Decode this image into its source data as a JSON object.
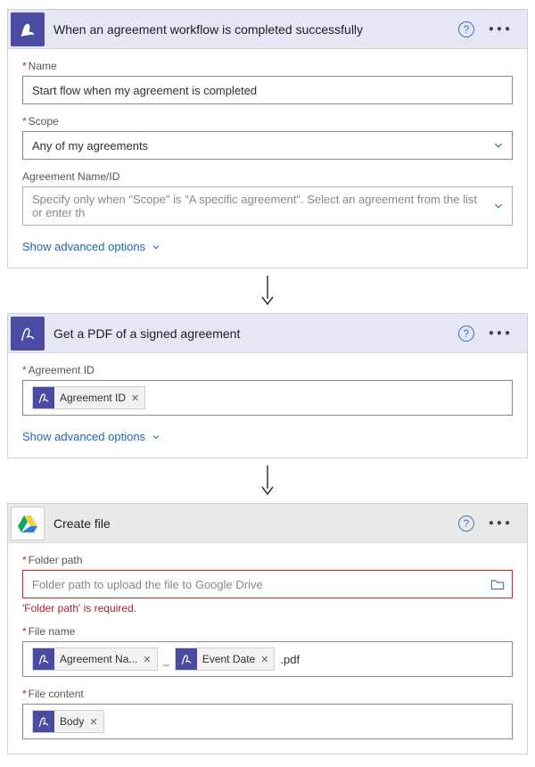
{
  "card1": {
    "title": "When an agreement workflow is completed successfully",
    "name_label": "Name",
    "name_value": "Start flow when my agreement is completed",
    "scope_label": "Scope",
    "scope_value": "Any of my agreements",
    "agreement_label": "Agreement Name/ID",
    "agreement_placeholder": "Specify only when \"Scope\" is \"A specific agreement\". Select an agreement from the list or enter th",
    "show_advanced": "Show advanced options"
  },
  "card2": {
    "title": "Get a PDF of a signed agreement",
    "agreement_id_label": "Agreement ID",
    "token_agreement_id": "Agreement ID",
    "show_advanced": "Show advanced options"
  },
  "card3": {
    "title": "Create file",
    "folder_label": "Folder path",
    "folder_placeholder": "Folder path to upload the file to Google Drive",
    "folder_error": "'Folder path' is required.",
    "filename_label": "File name",
    "token_agreement_name": "Agreement Na...",
    "token_event_date": "Event Date",
    "filename_suffix": ".pdf",
    "filecontent_label": "File content",
    "token_body": "Body"
  }
}
